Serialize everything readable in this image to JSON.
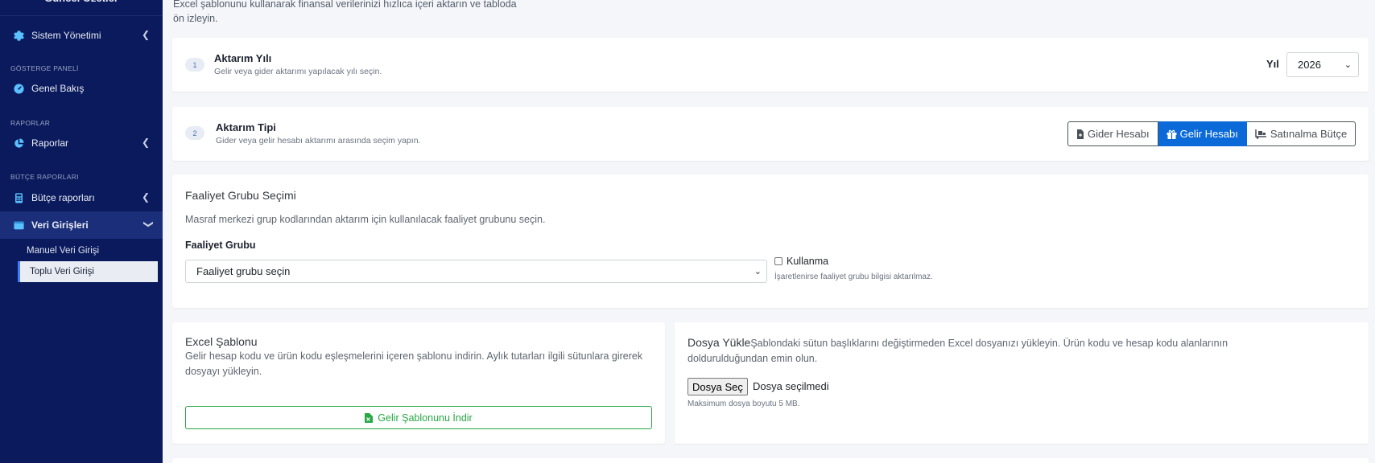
{
  "sidebar": {
    "brand": "Güncel Özetler",
    "items": {
      "sistem": "Sistem Yönetimi",
      "genel": "Genel Bakış",
      "raporlar": "Raporlar",
      "butce": "Bütçe raporları",
      "veri": "Veri Girişleri"
    },
    "headers": {
      "gosterge": "GÖSTERGE PANELİ",
      "raporlar": "RAPORLAR",
      "butce": "BÜTÇE RAPORLARI"
    },
    "subitems": {
      "manuel": "Manuel Veri Girişi",
      "toplu": "Toplu Veri Girişi"
    }
  },
  "main": {
    "intro": "Excel şablonunu kullanarak finansal verilerinizi hızlıca içeri aktarın ve tabloda ön izleyin.",
    "step1": {
      "number": "1",
      "title": "Aktarım Yılı",
      "desc": "Gelir veya gider aktarımı yapılacak yılı seçin.",
      "year_label": "Yıl",
      "year_value": "2026"
    },
    "step2": {
      "number": "2",
      "title": "Aktarım Tipi",
      "desc": "Gider veya gelir hesabı aktarımı arasında seçim yapın.",
      "options": [
        "Gider Hesabı",
        "Gelir Hesabı",
        "Satınalma Bütçe"
      ],
      "selected": "Gelir Hesabı"
    },
    "faaliyet": {
      "title": "Faaliyet Grubu Seçimi",
      "desc": "Masraf merkezi grup kodlarından aktarım için kullanılacak faaliyet grubunu seçin.",
      "label": "Faaliyet Grubu",
      "select_value": "Faaliyet grubu seçin",
      "checkbox_label": "Kullanma",
      "checkbox_note": "İşaretlenirse faaliyet grubu bilgisi aktarılmaz."
    },
    "excel": {
      "title": "Excel Şablonu",
      "desc": "Gelir hesap kodu ve ürün kodu eşleşmelerini içeren şablonu indirin. Aylık tutarları ilgili sütunlara girerek dosyayı yükleyin.",
      "button": "Gelir Şablonunu İndir"
    },
    "upload": {
      "title": "Dosya Yükle",
      "desc": "Şablondaki sütun başlıklarını değiştirmeden Excel dosyanızı yükleyin. Ürün kodu ve hesap kodu alanlarının doldurulduğundan emin olun.",
      "file_button": "Dosya Seç",
      "file_status": "Dosya seçilmedi",
      "note": "Maksimum dosya boyutu 5 MB."
    }
  },
  "colors": {
    "sidebar_bg": "#0a1a5c",
    "accent": "#0b6ad7",
    "success": "#28a745"
  }
}
